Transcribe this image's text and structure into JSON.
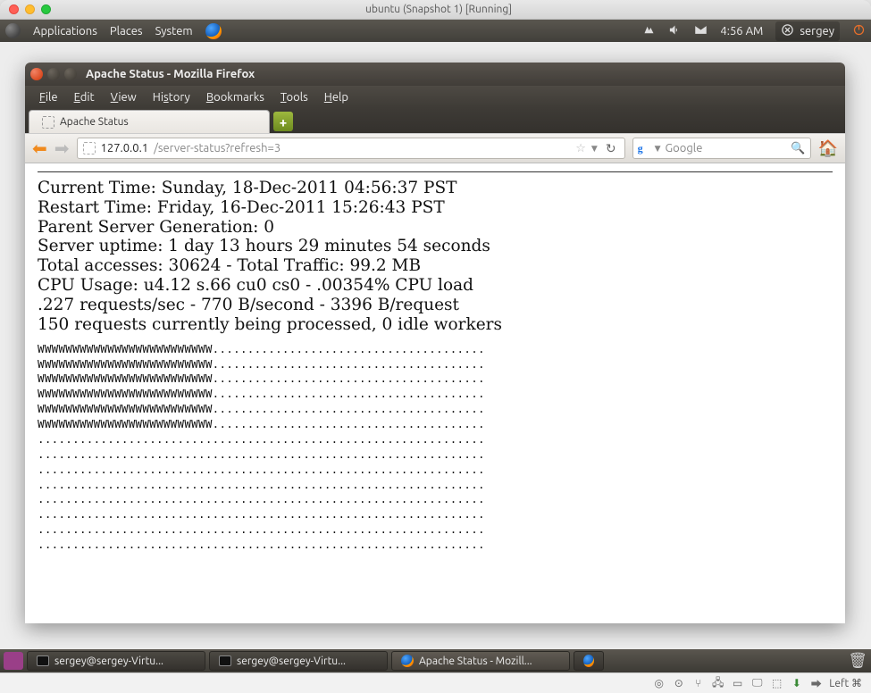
{
  "host_titlebar": "ubuntu (Snapshot 1) [Running]",
  "gnome": {
    "apps": "Applications",
    "places": "Places",
    "system": "System",
    "time": "4:56 AM",
    "user": "sergey"
  },
  "firefox": {
    "window_title": "Apache Status - Mozilla Firefox",
    "menu": {
      "file": "File",
      "edit": "Edit",
      "view": "View",
      "history": "History",
      "bookmarks": "Bookmarks",
      "tools": "Tools",
      "help": "Help"
    },
    "tab_title": "Apache Status",
    "url_host": "127.0.0.1",
    "url_path": "/server-status?refresh=3",
    "search_placeholder": "Google"
  },
  "status": {
    "current_time_line": "Current Time: Sunday, 18-Dec-2011 04:56:37 PST",
    "restart_time_line": "Restart Time: Friday, 16-Dec-2011 15:26:43 PST",
    "parent_gen_line": "Parent Server Generation: 0",
    "uptime_line": "Server uptime: 1 day 13 hours 29 minutes 54 seconds",
    "access_line": "Total accesses: 30624 - Total Traffic: 99.2 MB",
    "cpu_line": "CPU Usage: u4.12 s.66 cu0 cs0 - .00354% CPU load",
    "rate_line": ".227 requests/sec - 770 B/second - 3396 B/request",
    "busy_line": "150 requests currently being processed, 0 idle workers",
    "scoreboard": "WWWWWWWWWWWWWWWWWWWWWWWWW.......................................\nWWWWWWWWWWWWWWWWWWWWWWWWW.......................................\nWWWWWWWWWWWWWWWWWWWWWWWWW.......................................\nWWWWWWWWWWWWWWWWWWWWWWWWW.......................................\nWWWWWWWWWWWWWWWWWWWWWWWWW.......................................\nWWWWWWWWWWWWWWWWWWWWWWWWW.......................................\n................................................................\n................................................................\n................................................................\n................................................................\n................................................................\n................................................................\n................................................................\n................................................................"
  },
  "taskbar": {
    "term1": "sergey@sergey-Virtu...",
    "term2": "sergey@sergey-Virtu...",
    "ff": "Apache Status - Mozill..."
  },
  "host_status": {
    "left_text": "Left ⌘"
  }
}
